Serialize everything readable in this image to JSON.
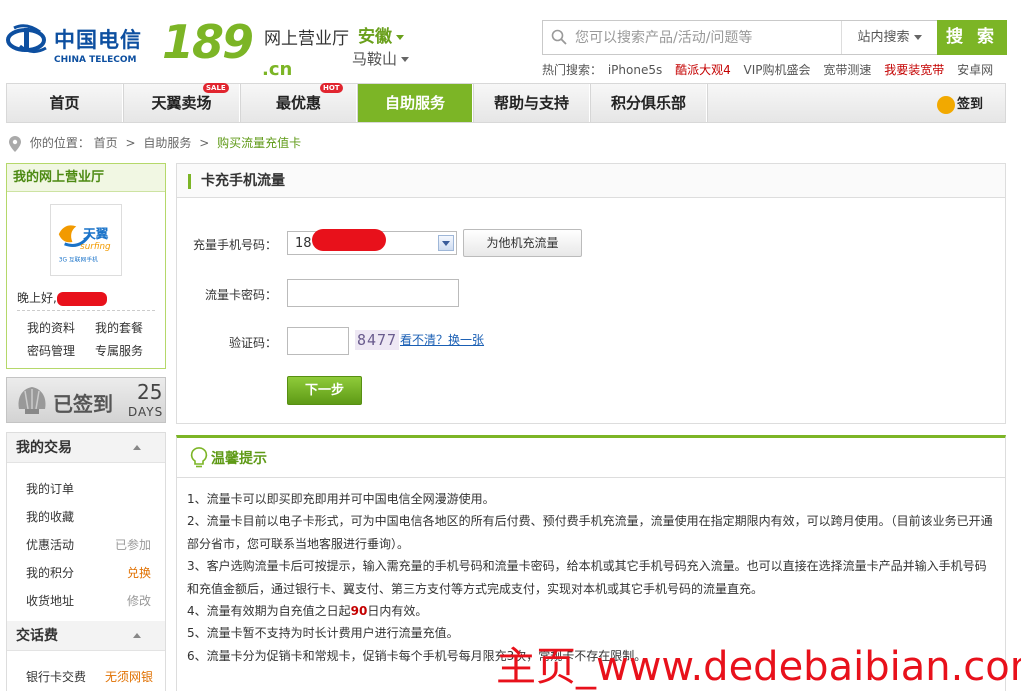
{
  "header": {
    "logo_cn": "中国电信",
    "logo_en": "CHINA TELECOM",
    "logo_189": "189",
    "logo_dotcn": ".cn",
    "hall": "网上营业厅",
    "province": "安徽",
    "city": "马鞍山",
    "search_placeholder": "您可以搜索产品/活动/问题等",
    "search_scope": "站内搜索",
    "search_button": "搜 索",
    "hot_label": "热门搜索：",
    "hot_items": [
      "iPhone5s",
      "酷派大观4",
      "VIP购机盛会",
      "宽带测速",
      "我要装宽带",
      "安卓网"
    ]
  },
  "nav": {
    "items": [
      "首页",
      "天翼卖场",
      "最优惠",
      "自助服务",
      "帮助与支持",
      "积分俱乐部"
    ],
    "badge_sale": "SALE",
    "badge_hot": "HOT",
    "signin": "签到",
    "active": "自助服务",
    "accent_color": "#7cb526"
  },
  "breadcrumb": {
    "label": "你的位置：",
    "home": "首页",
    "sep": ">",
    "section": "自助服务",
    "current": "购买流量充值卡"
  },
  "sidebar": {
    "my_hall_title": "我的网上营业厅",
    "avatar_brand": "天翼",
    "avatar_sub": "surfing",
    "avatar_caption": "3G 互联网手机",
    "greeting": "晚上好,",
    "links": [
      "我的资料",
      "我的套餐",
      "密码管理",
      "专属服务"
    ],
    "signed_text": "已签到",
    "signed_days": "25",
    "signed_days_label": "DAYS",
    "trade_title": "我的交易",
    "trade_rows": [
      {
        "label": "我的订单",
        "right": ""
      },
      {
        "label": "我的收藏",
        "right": ""
      },
      {
        "label": "优惠活动",
        "right": "已参加"
      },
      {
        "label": "我的积分",
        "right": "兑换"
      },
      {
        "label": "收货地址",
        "right": "修改"
      }
    ],
    "fee_title": "交话费",
    "fee_rows": [
      {
        "label": "银行卡交费",
        "right": "无须网银"
      }
    ]
  },
  "form": {
    "title": "卡充手机流量",
    "phone_label": "充量手机号码：",
    "phone_value": "18",
    "other_button": "为他机充流量",
    "pwd_label": "流量卡密码：",
    "captcha_label": "验证码：",
    "captcha_image": "8477",
    "captcha_link": "看不清？换一张",
    "next_button": "下一步"
  },
  "tips": {
    "title": "温馨提示",
    "items": [
      "1、流量卡可以即买即充即用并可中国电信全网漫游使用。",
      "2、流量卡目前以电子卡形式，可为中国电信各地区的所有后付费、预付费手机充流量，流量使用在指定期限内有效，可以跨月使用。（目前该业务已开通部分省市，您可联系当地客服进行垂询）。",
      "3、客户选购流量卡后可按提示，输入需充量的手机号码和流量卡密码，给本机或其它手机号码充入流量。也可以直接在选择流量卡产品并输入手机号码和充值金额后，通过银行卡、翼支付、第三方支付等方式完成支付，实现对本机或其它手机号码的流量直充。",
      "4、流量有效期为自充值之日起",
      "5、流量卡暂不支持为时长计费用户进行流量充值。",
      "6、流量卡分为促销卡和常规卡，促销卡每个手机号每月限充3次，常规卡不存在限制。"
    ],
    "item4_days": "90",
    "item4_suffix": "日内有效。"
  },
  "watermark": "主页_www.dedebaibian.com"
}
